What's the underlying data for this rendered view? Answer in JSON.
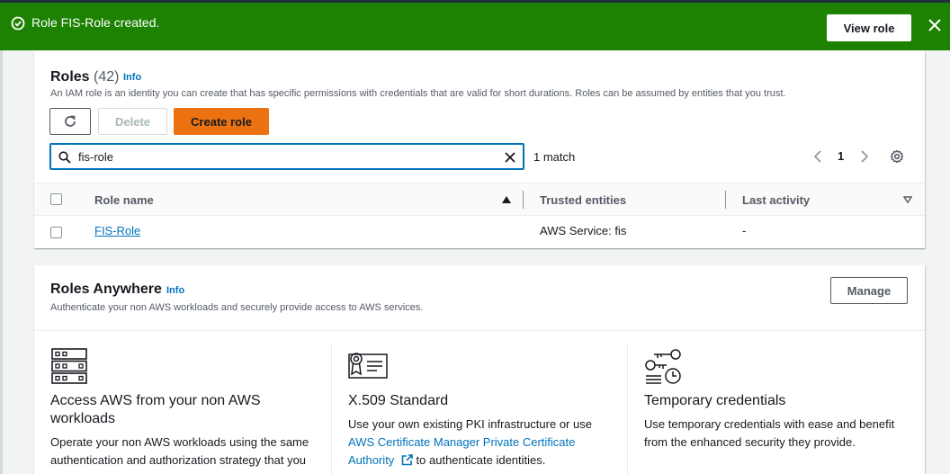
{
  "flash": {
    "message": "Role FIS-Role created.",
    "view_button": "View role",
    "icons": {
      "status": "check-circle-icon",
      "close": "close-icon"
    },
    "color": "#1d8102"
  },
  "roles": {
    "title": "Roles",
    "count": "(42)",
    "info": "Info",
    "description": "An IAM role is an identity you can create that has specific permissions with credentials that are valid for short durations. Roles can be assumed by entities that you trust.",
    "buttons": {
      "refresh_icon": "refresh-icon",
      "delete": "Delete",
      "create": "Create role"
    },
    "search": {
      "value": "fis-role",
      "placeholder": "Search"
    },
    "match_text": "1 match",
    "page": "1",
    "columns": [
      "Role name",
      "Trusted entities",
      "Last activity"
    ],
    "rows": [
      {
        "role_name": "FIS-Role",
        "trusted_entities": "AWS Service: fis",
        "last_activity": "-"
      }
    ]
  },
  "anywhere": {
    "title": "Roles Anywhere",
    "info": "Info",
    "manage_button": "Manage",
    "description": "Authenticate your non AWS workloads and securely provide access to AWS services.",
    "cards": [
      {
        "icon": "server-rack-icon",
        "title_line1": "Access AWS from your non AWS",
        "title_line2": "workloads",
        "text_line1": "Operate your non AWS workloads using the same",
        "text_line2": "authentication and authorization strategy that you"
      },
      {
        "icon": "certificate-icon",
        "title_line1": "X.509 Standard",
        "text_line1": "Use your own existing PKI infrastructure or use",
        "link_line1": "AWS Certificate Manager Private Certificate",
        "link_line2": "Authority",
        "external_icon": "external-link-icon",
        "text_after_link": " to authenticate identities."
      },
      {
        "icon": "keys-clock-icon",
        "title_line1": "Temporary credentials",
        "text_line1": "Use temporary credentials with ease and benefit",
        "text_line2": "from the enhanced security they provide."
      }
    ]
  }
}
